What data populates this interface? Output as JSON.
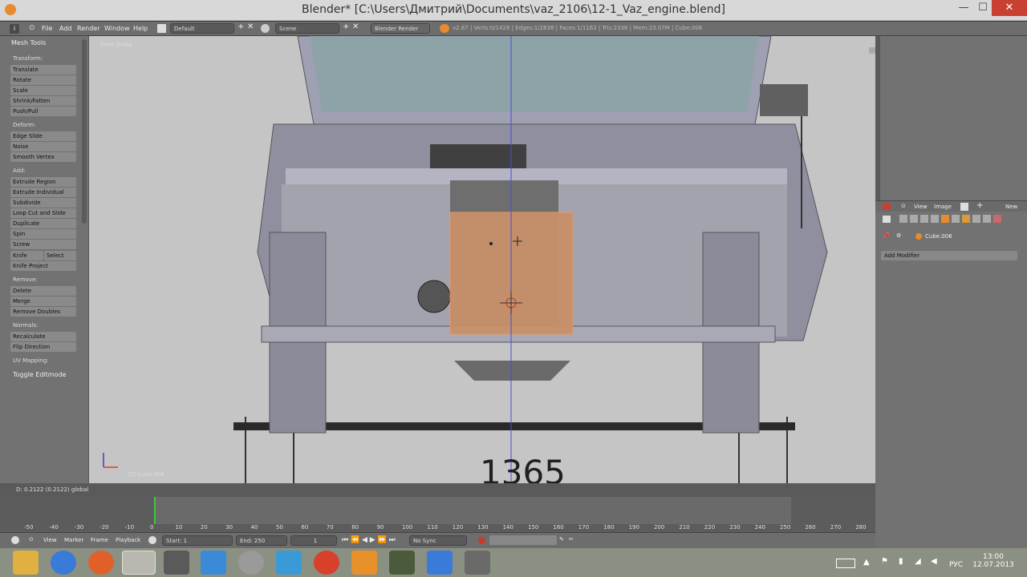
{
  "window": {
    "title": "Blender* [C:\\Users\\Дмитрий\\Documents\\vaz_2106\\12-1_Vaz_engine.blend]",
    "minimize": "—",
    "maximize": "☐",
    "close": "✕"
  },
  "info_header": {
    "menus": [
      "File",
      "Add",
      "Render",
      "Window",
      "Help"
    ],
    "layout": "Default",
    "scene": "Scene",
    "engine": "Blender Render",
    "stats": "v2.67 | Verts:0/1428 | Edges:1/2838 | Faces:1/1162 | Tris:2338 | Mem:23.07M | Cube.006"
  },
  "tool_panel": {
    "title": "Mesh Tools",
    "transform_label": "Transform:",
    "transform": [
      "Translate",
      "Rotate",
      "Scale",
      "Shrink/Fatten",
      "Push/Pull"
    ],
    "deform_label": "Deform:",
    "deform": [
      "Edge Slide",
      "Noise",
      "Smooth Vertex"
    ],
    "add_label": "Add:",
    "add": [
      "Extrude Region",
      "Extrude Individual",
      "Subdivide",
      "Loop Cut and Slide",
      "Duplicate",
      "Spin",
      "Screw"
    ],
    "knife": "Knife",
    "select": "Select",
    "knife_project": "Knife Project",
    "remove_label": "Remove:",
    "remove": [
      "Delete",
      "Merge",
      "Remove Doubles"
    ],
    "normals_label": "Normals:",
    "normals": [
      "Recalculate",
      "Flip Direction"
    ],
    "uv_label": "UV Mapping:",
    "toggle": "Toggle Editmode"
  },
  "viewport": {
    "view_name": "Front Ortho",
    "object_label": "(1) Cube.006",
    "dimension": "1365"
  },
  "status": {
    "text": "D: 0.2122 (0.2122) global"
  },
  "properties": {
    "view": "View",
    "image": "Image",
    "new": "New",
    "object": "Cube.006",
    "add_modifier": "Add Modifier"
  },
  "timeline": {
    "numbers": [
      "-50",
      "-40",
      "-30",
      "-20",
      "-10",
      "0",
      "10",
      "20",
      "30",
      "40",
      "50",
      "60",
      "70",
      "80",
      "90",
      "100",
      "110",
      "120",
      "130",
      "140",
      "150",
      "160",
      "170",
      "180",
      "190",
      "200",
      "210",
      "220",
      "230",
      "240",
      "250",
      "260",
      "270",
      "280"
    ],
    "menus": [
      "View",
      "Marker",
      "Frame",
      "Playback"
    ],
    "start": "Start: 1",
    "end": "End: 250",
    "current": "1",
    "sync": "No Sync"
  },
  "taskbar": {
    "lang": "РУС",
    "time": "13:00",
    "date": "12.07.2013"
  },
  "colors": {
    "accent": "#e88a2e",
    "selected_face": "#c8906a"
  }
}
